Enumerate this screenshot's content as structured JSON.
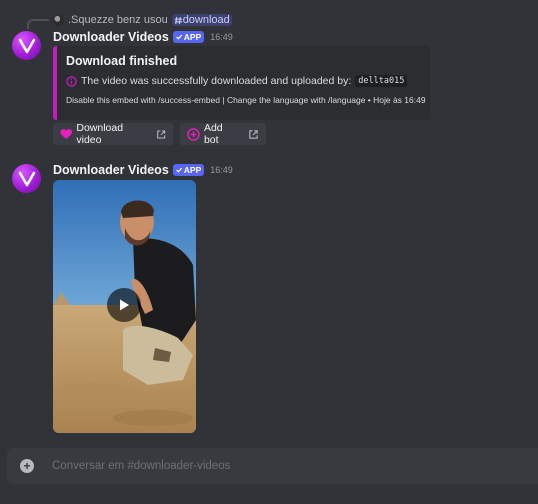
{
  "reply": {
    "user": ".Squezze benz usou",
    "command": "download"
  },
  "messages": [
    {
      "username": "Downloader Videos",
      "badge": "APP",
      "time": "16:49",
      "embed": {
        "title": "Download finished",
        "description": "The video was successfully downloaded and uploaded by:",
        "uploader": "dellta015",
        "footer": "Disable this embed with /success-embed | Change the language with /language • Hoje às 16:49",
        "accent_color": "#c51bc1"
      },
      "buttons": [
        {
          "label": "Download video",
          "icon": "heart-icon"
        },
        {
          "label": "Add bot",
          "icon": "plus-circle-icon"
        }
      ]
    },
    {
      "username": "Downloader Videos",
      "badge": "APP",
      "time": "16:49"
    }
  ],
  "composer": {
    "placeholder": "Conversar em #downloader-videos"
  },
  "colors": {
    "background": "#313338",
    "brand": "#5865f2",
    "accent": "#c51bc1"
  }
}
